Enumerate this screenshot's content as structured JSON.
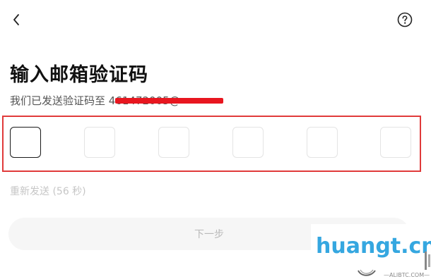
{
  "header": {
    "back_icon": "chevron-left-icon",
    "help_icon": "question-circle-icon"
  },
  "page": {
    "title": "输入邮箱验证码",
    "subtitle_prefix": "我们已发送验证码至",
    "masked_email": "461472005@"
  },
  "otp": {
    "length": 6,
    "values": [
      "",
      "",
      "",
      "",
      "",
      ""
    ],
    "active_index": 0
  },
  "resend_label": "重新发送 (56 秒)",
  "next_button_label": "下一步",
  "watermark": {
    "main": "huangt.cn",
    "sub": "—ALIBTC.COM—"
  },
  "colors": {
    "highlight_border": "#e03a3a",
    "redaction": "#e8161f",
    "watermark": "#35a7e0"
  }
}
